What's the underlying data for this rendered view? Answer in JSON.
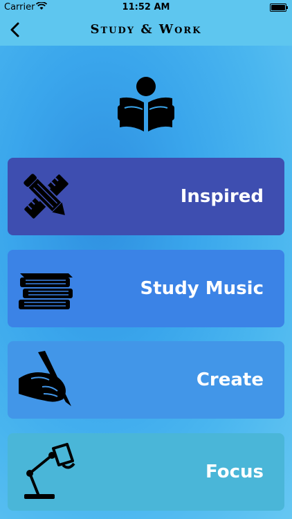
{
  "status_bar": {
    "carrier": "Carrier",
    "time": "11:52 AM"
  },
  "nav": {
    "title": "Study & Work",
    "back_icon": "chevron-left-icon"
  },
  "hero": {
    "icon": "reading-person-icon"
  },
  "cards": [
    {
      "label": "Inspired",
      "icon": "pencil-ruler-icon",
      "color": "#3e4eb0"
    },
    {
      "label": "Study Music",
      "icon": "book-stack-icon",
      "color": "#3b83e6"
    },
    {
      "label": "Create",
      "icon": "hand-writing-icon",
      "color": "#4296e8"
    },
    {
      "label": "Focus",
      "icon": "desk-lamp-icon",
      "color": "#4ab6d8"
    }
  ],
  "colors": {
    "nav_background": "#5ec6ef",
    "background_center": "#2f8fe0",
    "label_text": "#ffffff"
  }
}
